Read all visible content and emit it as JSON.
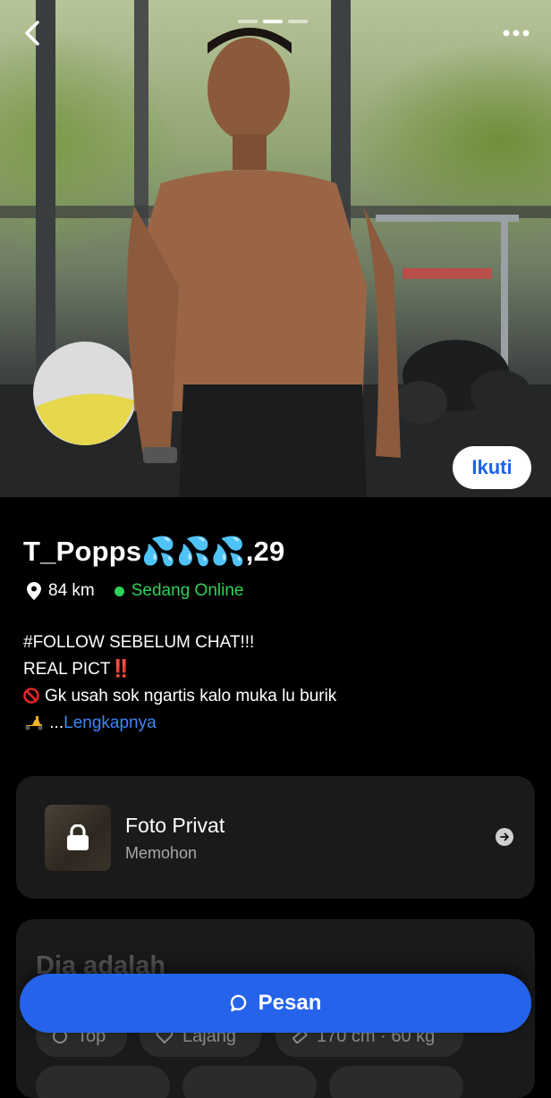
{
  "hero": {
    "alt": "Profile photo",
    "pager_count": 3,
    "pager_active": 1,
    "follow_label": "Ikuti"
  },
  "profile": {
    "name": "T_Popps💦💦💦",
    "age_suffix": ",29",
    "distance": "84 km",
    "status": "Sedang Online",
    "status_color": "#2fd158",
    "bio": {
      "line1": "#FOLLOW SEBELUM CHAT!!!",
      "line2": "REAL PICT",
      "line2_emoji": "‼️",
      "line3": "Gk usah sok ngartis kalo muka lu burik",
      "line4_prefix": " ...",
      "more_label": "Lengkapnya"
    }
  },
  "private_photo": {
    "title": "Foto Privat",
    "subtitle": "Memohon"
  },
  "about": {
    "title": "Dia adalah",
    "chips": [
      {
        "label": "Top"
      },
      {
        "label": "Lajang"
      },
      {
        "label": "170 cm · 60 kg"
      }
    ]
  },
  "message_button": {
    "label": "Pesan"
  },
  "colors": {
    "accent": "#2563eb",
    "link": "#3d85f5",
    "card_bg": "#1a1a1a"
  }
}
